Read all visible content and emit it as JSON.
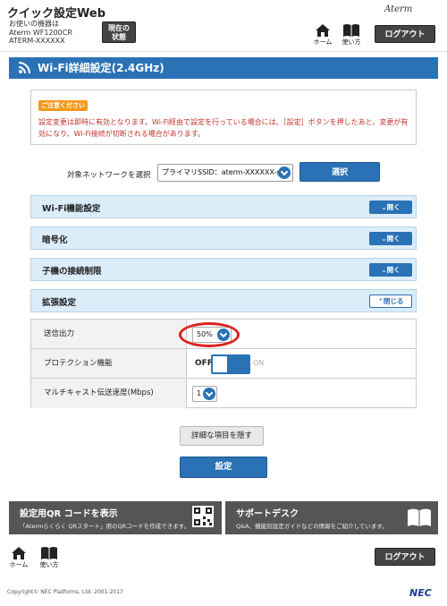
{
  "header": {
    "app_title": "クイック設定Web",
    "device_line1": "お使いの機器は",
    "device_line2": "Aterm WF1200CR",
    "device_line3": "ATERM-XXXXXX",
    "status_btn_line1": "現在の",
    "status_btn_line2": "状態",
    "logo": "Aterm",
    "home_label": "ホーム",
    "manual_label": "使い方",
    "logout_label": "ログアウト"
  },
  "section": {
    "title": "Wi-Fi詳細設定(2.4GHz)"
  },
  "notice": {
    "badge": "ご注意ください",
    "text": "設定変更は即時に有効となります。Wi-Fi経由で設定を行っている場合には、［設定］ボタンを押したあと、変更が有効になり、Wi-Fi接続が切断される場合があります。"
  },
  "network_select": {
    "label": "対象ネットワークを選択",
    "value": "プライマリSSID：aterm-XXXXXX-g",
    "button": "選択"
  },
  "accordions": [
    {
      "label": "Wi-Fi機能設定",
      "button": "開く"
    },
    {
      "label": "暗号化",
      "button": "開く"
    },
    {
      "label": "子機の接続制限",
      "button": "開く"
    },
    {
      "label": "拡張設定",
      "button": "閉じる"
    }
  ],
  "extended": {
    "tx_power_label": "送信出力",
    "tx_power_value": "50%",
    "protection_label": "プロテクション機能",
    "protection_off": "OFF",
    "protection_on": "ON",
    "multicast_label": "マルチキャスト伝送速度(Mbps)",
    "multicast_value": "1"
  },
  "actions": {
    "hide_details": "詳細な項目を隠す",
    "apply": "設定"
  },
  "panels": {
    "qr_title": "設定用QR コードを表示",
    "qr_sub": "「Atermらくらく QRスタート」用のQRコードを作成できます。",
    "support_title": "サポートデスク",
    "support_sub": "Q&A、機能別設定ガイドなどの情報をご紹介しています。"
  },
  "footer": {
    "home_label": "ホーム",
    "manual_label": "使い方",
    "logout_label": "ログアウト",
    "copyright": "Copyright© NEC Platforms, Ltd. 2001-2017",
    "brand": "NEC"
  },
  "colors": {
    "accent_blue": "#2a72b5",
    "accordion_bg": "#dcedfa",
    "notice_badge": "#f39a1c",
    "notice_text": "#c0332a",
    "highlight": "#e02020"
  }
}
